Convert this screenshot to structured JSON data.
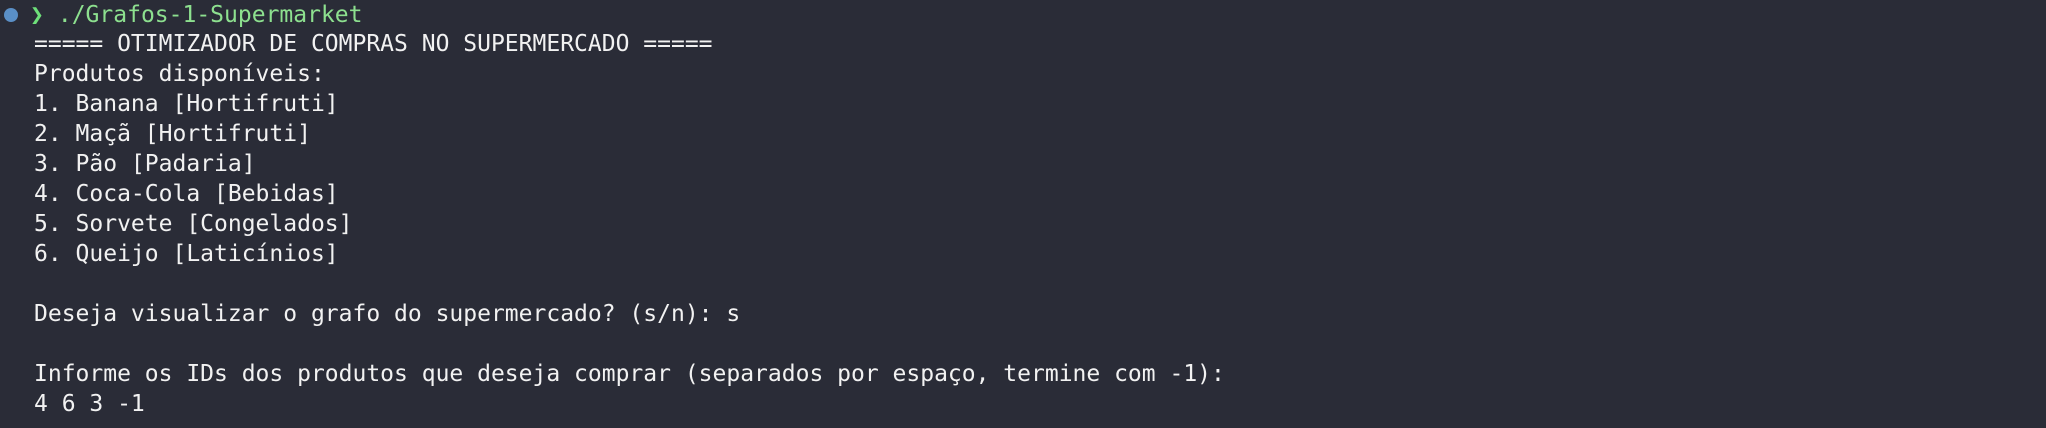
{
  "prompt": {
    "symbol": "❯",
    "command": "./Grafos-1-Supermarket"
  },
  "output_lines": [
    "===== OTIMIZADOR DE COMPRAS NO SUPERMERCADO =====",
    "Produtos disponíveis:",
    "1. Banana [Hortifruti]",
    "2. Maçã [Hortifruti]",
    "3. Pão [Padaria]",
    "4. Coca-Cola [Bebidas]",
    "5. Sorvete [Congelados]",
    "6. Queijo [Laticínios]",
    "",
    "Deseja visualizar o grafo do supermercado? (s/n): s",
    "",
    "Informe os IDs dos produtos que deseja comprar (separados por espaço, termine com -1):",
    "4 6 3 -1"
  ],
  "colors": {
    "background": "#2a2c37",
    "text": "#f2f2f2",
    "prompt_green": "#6ee07a",
    "status_dot": "#5a8fc6"
  }
}
